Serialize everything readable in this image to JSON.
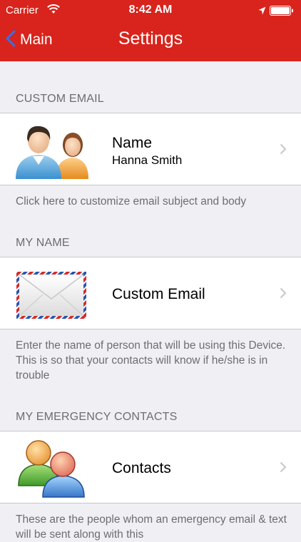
{
  "status_bar": {
    "carrier": "Carrier",
    "time": "8:42 AM",
    "icons": [
      "wifi-icon",
      "location-arrow-icon",
      "battery-icon"
    ]
  },
  "nav_bar": {
    "back_label": "Main",
    "title": "Settings",
    "background_color": "#d8241c"
  },
  "sections": [
    {
      "header": "CUSTOM EMAIL",
      "row": {
        "icon": "people-icon",
        "title": "Name",
        "subtitle": "Hanna Smith"
      },
      "footer": "Click here to customize email subject and body"
    },
    {
      "header": "MY NAME",
      "row": {
        "icon": "envelope-icon",
        "title": "Custom Email"
      },
      "footer": "Enter the name of person that will be using this Device. This is so that your contacts  will know if he/she is in trouble"
    },
    {
      "header": "MY EMERGENCY CONTACTS",
      "row": {
        "icon": "contacts-icon",
        "title": "Contacts"
      },
      "footer": "These are the people whom an emergency email & text will be sent along with this"
    }
  ]
}
